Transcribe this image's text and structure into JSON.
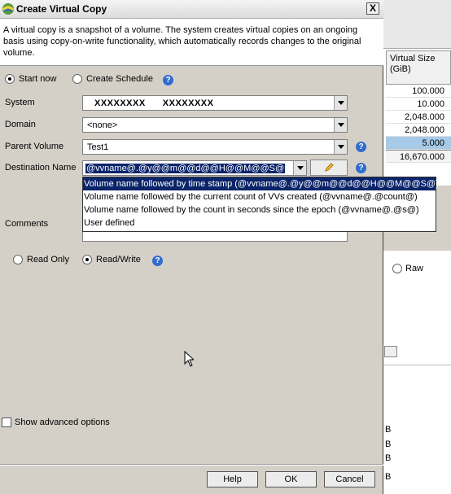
{
  "dialog": {
    "title": "Create Virtual Copy",
    "close_label": "X",
    "description": "A virtual copy is a snapshot of a volume. The system creates virtual copies on an ongoing basis using copy-on-write functionality, which automatically records changes to the original volume."
  },
  "mode": {
    "start_now": "Start now",
    "create_schedule": "Create Schedule",
    "selected": "start_now"
  },
  "form": {
    "system_label": "System",
    "system_value_a": "XXXXXXXX",
    "system_value_b": "XXXXXXXX",
    "domain_label": "Domain",
    "domain_value": "<none>",
    "parent_label": "Parent Volume",
    "parent_value": "Test1",
    "dest_label": "Destination Name",
    "dest_value": "@vvname@.@y@@m@@d@@H@@M@@S@",
    "comments_label": "Comments"
  },
  "dropdown_options": [
    "Volume name followed by time stamp (@vvname@.@y@@m@@d@@H@@M@@S@)",
    "Volume name followed by the current count of VVs created (@vvname@.@count@)",
    "Volume name followed by the count in seconds since the epoch (@vvname@.@s@)",
    "User defined"
  ],
  "access": {
    "read_only": "Read Only",
    "read_write": "Read/Write",
    "selected": "read_write"
  },
  "advanced": {
    "label": "Show advanced options",
    "checked": false
  },
  "buttons": {
    "help": "Help",
    "ok": "OK",
    "cancel": "Cancel"
  },
  "background": {
    "column_header": "Virtual Size (GiB)",
    "rows": [
      "100.000",
      "10.000",
      "2,048.000",
      "2,048.000",
      "5.000"
    ],
    "total": "16,670.000",
    "raw_label": "Raw",
    "b_labels": [
      "B",
      "B",
      "B",
      "B"
    ]
  },
  "colors": {
    "selection": "#0a246a",
    "help_icon": "#2f6ccf",
    "bg_row_selected": "#a6cae8"
  }
}
